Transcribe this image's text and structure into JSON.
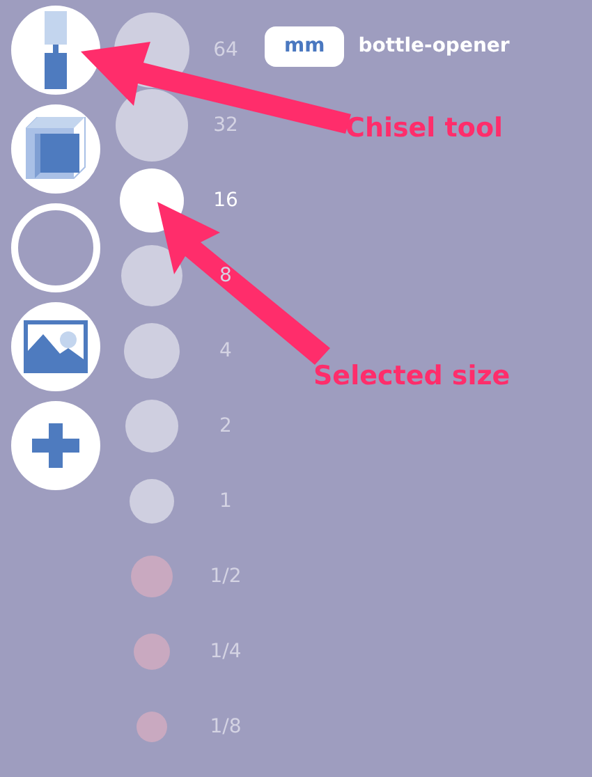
{
  "tools": [
    {
      "kind": "chisel"
    },
    {
      "kind": "cube"
    },
    {
      "kind": "ring"
    },
    {
      "kind": "image"
    },
    {
      "kind": "plus"
    }
  ],
  "sizes": [
    {
      "label": "64",
      "selected": false,
      "color": "#cfcfe0"
    },
    {
      "label": "32",
      "selected": false,
      "color": "#cfcfe0"
    },
    {
      "label": "16",
      "selected": true,
      "color": "#ffffff"
    },
    {
      "label": "8",
      "selected": false,
      "color": "#cfcfe0"
    },
    {
      "label": "4",
      "selected": false,
      "color": "#cfcfe0"
    },
    {
      "label": "2",
      "selected": false,
      "color": "#cfcfe0"
    },
    {
      "label": "1",
      "selected": false,
      "color": "#cfcfe0"
    },
    {
      "label": "1/2",
      "selected": false,
      "color": "#c9a9c0"
    },
    {
      "label": "1/4",
      "selected": false,
      "color": "#c9a9c0"
    },
    {
      "label": "1/8",
      "selected": false,
      "color": "#c9a9c0"
    }
  ],
  "unit": "mm",
  "model_name": "bottle-opener",
  "annotations": [
    {
      "text": "Chisel tool"
    },
    {
      "text": "Selected size"
    }
  ]
}
